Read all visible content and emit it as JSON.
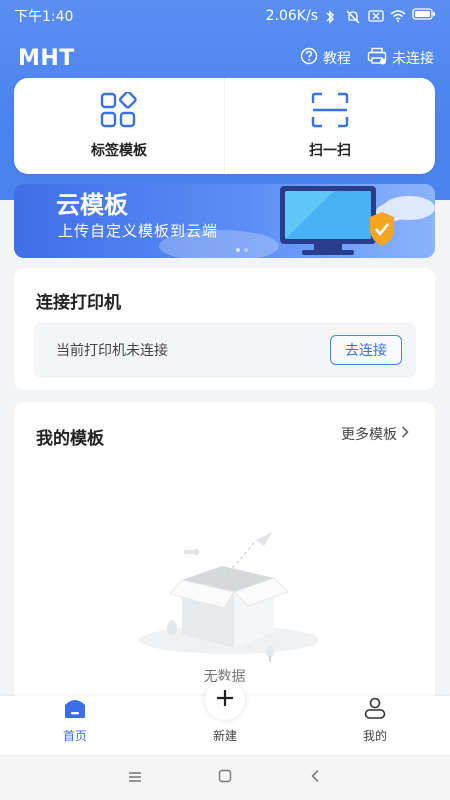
{
  "status_bar": {
    "time": "下午1:40",
    "speed": "2.06K/s"
  },
  "header": {
    "app_title": "MHT",
    "tutorial_label": "教程",
    "printer_state_label": "未连接"
  },
  "quick_actions": [
    {
      "label": "标签模板",
      "icon": "grid-icon"
    },
    {
      "label": "扫一扫",
      "icon": "scan-icon"
    }
  ],
  "banner": {
    "title": "云模板",
    "subtitle": "上传自定义模板到云端"
  },
  "printer_card": {
    "title": "连接打印机",
    "status_text": "当前打印机未连接",
    "connect_button": "去连接"
  },
  "templates_card": {
    "title": "我的模板",
    "more_label": "更多模板",
    "empty_text": "无数据"
  },
  "tabbar": {
    "tabs": [
      {
        "label": "首页",
        "icon": "home-icon",
        "active": true
      },
      {
        "label": "新建",
        "icon": "plus-icon",
        "active": false
      },
      {
        "label": "我的",
        "icon": "user-icon",
        "active": false
      }
    ]
  },
  "colors": {
    "accent": "#3a6fe6",
    "header_bg": "#4c84ef"
  }
}
